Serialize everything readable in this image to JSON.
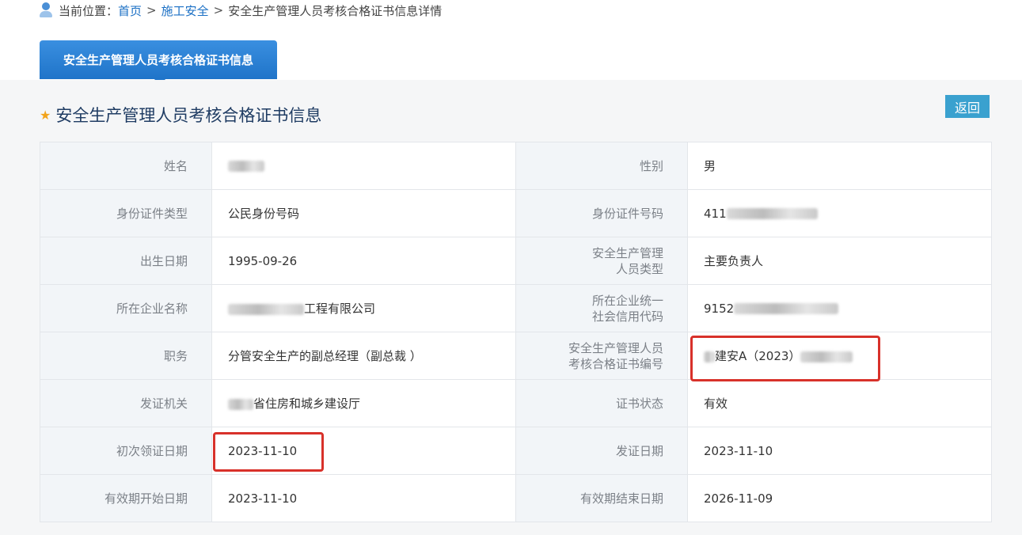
{
  "breadcrumb": {
    "prefix": "当前位置：",
    "home": "首页",
    "section": "施工安全",
    "current": "安全生产管理人员考核合格证书信息详情",
    "separator": ">"
  },
  "tab": {
    "label": "安全生产管理人员考核合格证书信息"
  },
  "section": {
    "title": "安全生产管理人员考核合格证书信息"
  },
  "back_button": "返回",
  "fields": {
    "name_label": "姓名",
    "name_value": "",
    "gender_label": "性别",
    "gender_value": "男",
    "id_type_label": "身份证件类型",
    "id_type_value": "公民身份号码",
    "id_number_label": "身份证件号码",
    "id_number_value": "411",
    "birth_label": "出生日期",
    "birth_value": "1995-09-26",
    "mgr_type_label_1": "安全生产管理",
    "mgr_type_label_2": "人员类型",
    "mgr_type_value": "主要负责人",
    "company_label": "所在企业名称",
    "company_value_suffix": "工程有限公司",
    "credit_label_1": "所在企业统一",
    "credit_label_2": "社会信用代码",
    "credit_value": "9152",
    "position_label": "职务",
    "position_value": "分管安全生产的副总经理（副总裁 ）",
    "cert_no_label_1": "安全生产管理人员",
    "cert_no_label_2": "考核合格证书编号",
    "cert_no_value": "建安A（2023）",
    "issuer_label": "发证机关",
    "issuer_value_suffix": "省住房和城乡建设厅",
    "status_label": "证书状态",
    "status_value": "有效",
    "first_issue_label": "初次领证日期",
    "first_issue_value": "2023-11-10",
    "issue_label": "发证日期",
    "issue_value": "2023-11-10",
    "valid_start_label": "有效期开始日期",
    "valid_start_value": "2023-11-10",
    "valid_end_label": "有效期结束日期",
    "valid_end_value": "2026-11-09"
  },
  "colors": {
    "tab_blue": "#1f74c9",
    "back_button": "#3aa1cf",
    "highlight_red": "#d8312a",
    "star": "#f2a31b"
  }
}
